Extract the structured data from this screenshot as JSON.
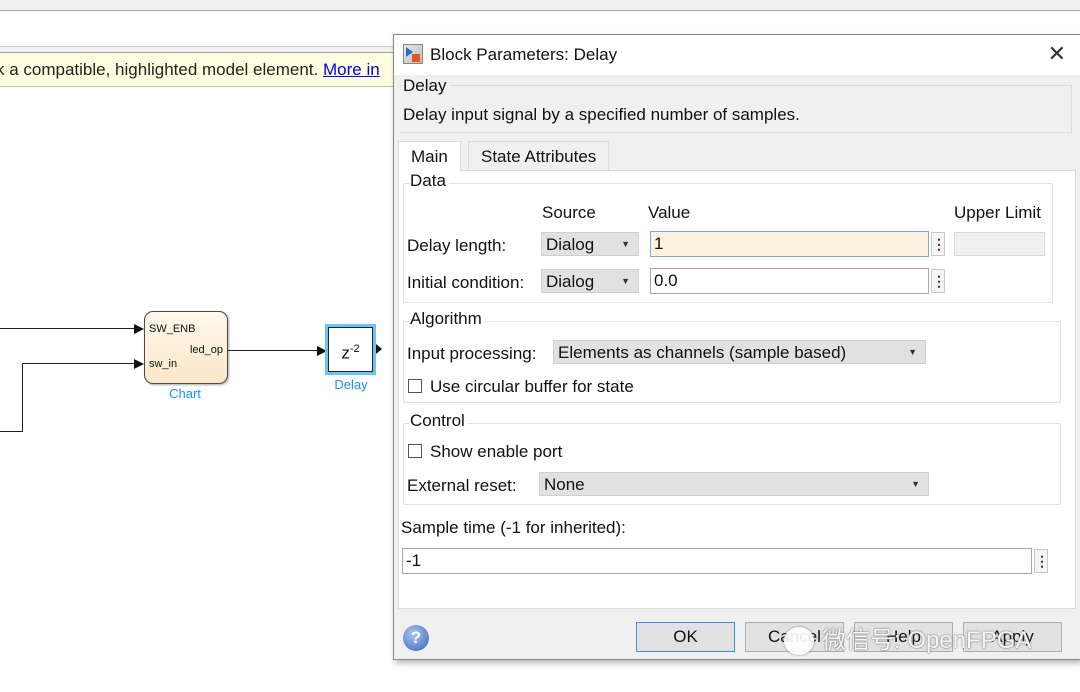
{
  "notice": {
    "message": "k a compatible, highlighted model element.",
    "link": "More in"
  },
  "diagram": {
    "chart_block": {
      "label": "Chart",
      "inputs": [
        "SW_ENB",
        "sw_in"
      ],
      "output": "led_op"
    },
    "delay_block": {
      "label": "Delay",
      "base": "z",
      "exponent": "-2"
    },
    "colors": {
      "selection": "#6ec3f5",
      "block_label": "#1e90ff"
    }
  },
  "dialog": {
    "title": "Block Parameters: Delay",
    "close_icon": "close-icon",
    "block_name": "Delay",
    "description": "Delay input signal by a specified number of samples.",
    "tabs": [
      {
        "label": "Main",
        "active": true
      },
      {
        "label": "State Attributes",
        "active": false
      }
    ],
    "data_group": {
      "title": "Data",
      "headers": {
        "source": "Source",
        "value": "Value",
        "upper_limit": "Upper Limit"
      },
      "rows": [
        {
          "label": "Delay length:",
          "source": "Dialog",
          "value": "1",
          "focused": true,
          "upper_limit": ""
        },
        {
          "label": "Initial condition:",
          "source": "Dialog",
          "value": "0.0",
          "focused": false
        }
      ]
    },
    "algorithm_group": {
      "title": "Algorithm",
      "input_processing_label": "Input processing:",
      "input_processing_value": "Elements as channels (sample based)",
      "circular_buffer_label": "Use circular buffer for state",
      "circular_buffer_checked": false
    },
    "control_group": {
      "title": "Control",
      "enable_port_label": "Show enable port",
      "enable_port_checked": false,
      "external_reset_label": "External reset:",
      "external_reset_value": "None"
    },
    "sample_time": {
      "label": "Sample time (-1 for inherited):",
      "value": "-1"
    },
    "buttons": {
      "ok": "OK",
      "cancel": "Cancel",
      "help": "Help",
      "apply": "Apply"
    },
    "help_icon": "?"
  },
  "watermark": "微信号: OpenFPGA"
}
